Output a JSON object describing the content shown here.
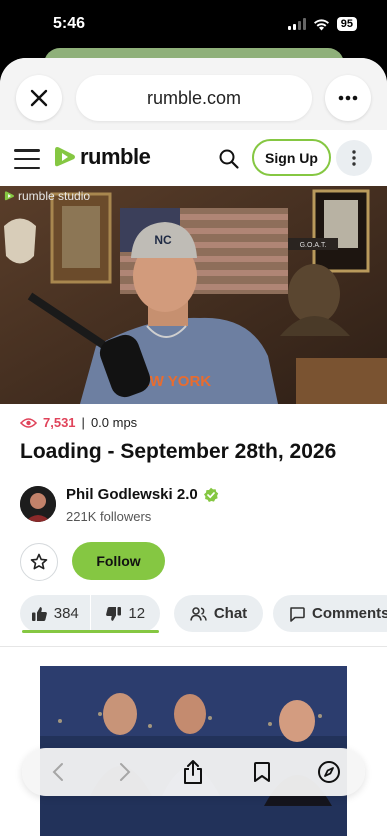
{
  "status_bar": {
    "time": "5:46",
    "battery": "95"
  },
  "browser": {
    "url": "rumble.com"
  },
  "nav": {
    "logo_text": "rumble",
    "signup_label": "Sign Up"
  },
  "video": {
    "studio_label": "rumble studio",
    "cap_text": "NC",
    "hat_text": "G.O.A.T.",
    "shirt_text": "NEW YORK"
  },
  "info": {
    "views": "7,531",
    "separator": "|",
    "mps": "0.0 mps",
    "title": "Loading - September 28th, 2026"
  },
  "channel": {
    "name": "Phil Godlewski 2.0",
    "followers": "221K followers"
  },
  "actions": {
    "follow_label": "Follow",
    "likes": "384",
    "dislikes": "12",
    "chat_label": "Chat",
    "comments_label": "Comments"
  },
  "colors": {
    "brand_green": "#85c742",
    "view_red": "#e0435a",
    "pill_gray": "#eaeef1"
  },
  "icons": [
    "close-icon",
    "ellipsis-icon",
    "hamburger-icon",
    "rumble-logo-icon",
    "search-icon",
    "vertical-ellipsis-icon",
    "eye-icon",
    "verified-icon",
    "star-icon",
    "thumbs-up-icon",
    "thumbs-down-icon",
    "chat-icon",
    "comment-icon",
    "back-icon",
    "forward-icon",
    "share-icon",
    "bookmarks-icon",
    "compass-icon"
  ]
}
